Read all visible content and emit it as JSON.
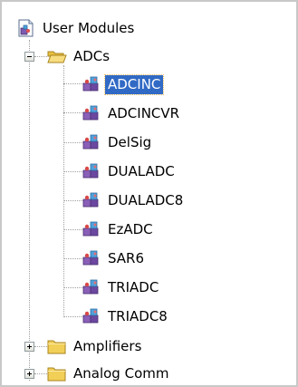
{
  "tree": {
    "root": {
      "label": "User Modules",
      "icon": "user-modules-icon"
    },
    "adcs": {
      "label": "ADCs",
      "expanded": true,
      "icon": "open-folder-icon",
      "children": [
        {
          "label": "ADCINC",
          "selected": true
        },
        {
          "label": "ADCINCVR"
        },
        {
          "label": "DelSig"
        },
        {
          "label": "DUALADC"
        },
        {
          "label": "DUALADC8"
        },
        {
          "label": "EzADC"
        },
        {
          "label": "SAR6"
        },
        {
          "label": "TRIADC"
        },
        {
          "label": "TRIADC8"
        }
      ]
    },
    "folders": [
      {
        "label": "Amplifiers",
        "expanded": false,
        "icon": "closed-folder-icon"
      },
      {
        "label": "Analog Comm",
        "expanded": false,
        "icon": "closed-folder-icon"
      }
    ]
  },
  "colors": {
    "selection": "#316ac5",
    "folder": "#f2cf57",
    "module_puzzle": "#8a5fb8"
  }
}
